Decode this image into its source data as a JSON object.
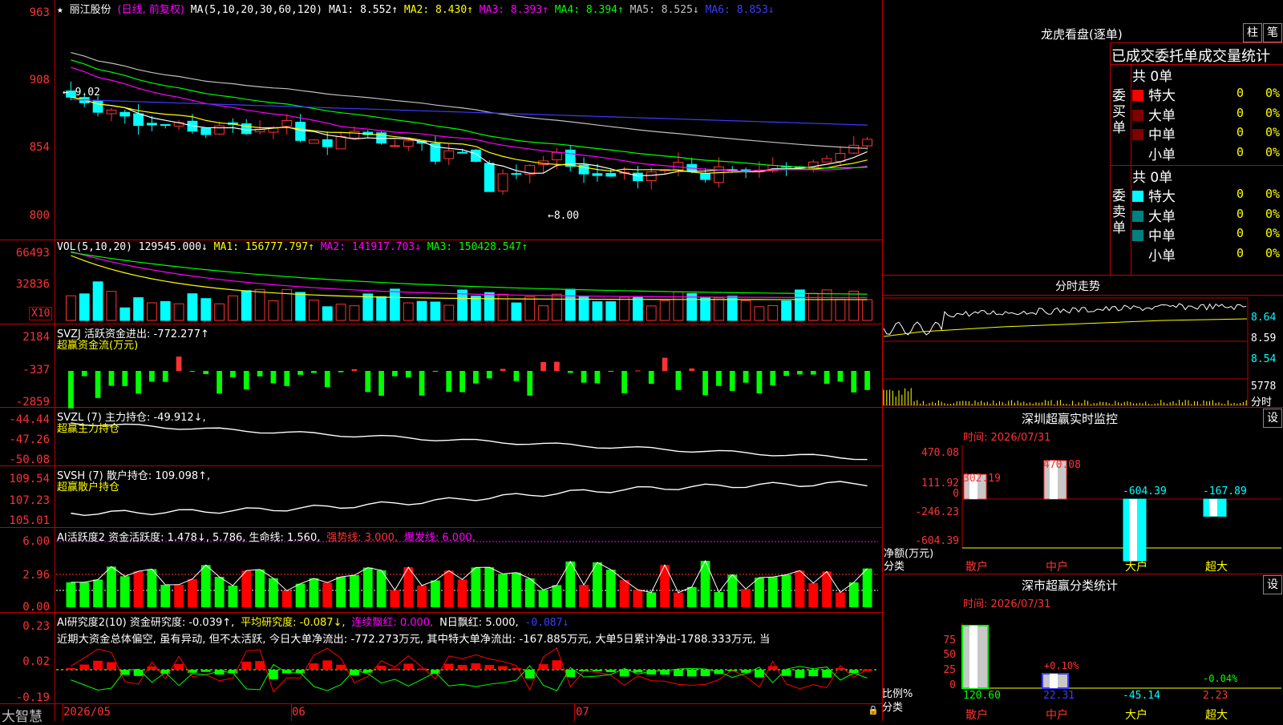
{
  "header": {
    "star": "★",
    "stock": "丽江股份",
    "period": "(日线, 前复权)",
    "ma_label": "MA(5,10,20,30,60,120)",
    "ma1": "MA1: 8.552↑",
    "ma2": "MA2: 8.430↑",
    "ma3": "MA3: 8.393↑",
    "ma4": "MA4: 8.394↑",
    "ma5": "MA5: 8.525↓",
    "ma6": "MA6: 8.853↓"
  },
  "price_axis": [
    "963",
    "908",
    "854",
    "800"
  ],
  "price_annotations": {
    "high": "← 9.02",
    "low": "←8.00"
  },
  "vol": {
    "label": "VOL(5,10,20)",
    "value": "129545.000↓",
    "ma1": "MA1: 156777.797↑",
    "ma2": "MA2: 141917.703↓",
    "ma3": "MA3: 150428.547↑",
    "axis": [
      "66493",
      "32836"
    ],
    "unit": "X10"
  },
  "svzj": {
    "label": "SVZJ  活跃资金进出: -772.277↑",
    "sub": "超赢资金流(万元)",
    "axis": [
      "2184",
      "-337",
      "-2859"
    ]
  },
  "svzl": {
    "label": "SVZL (7) 主力持仓: -49.912↓,",
    "sub": "超赢主力持仓",
    "axis": [
      "-44.44",
      "-47.26",
      "-50.08"
    ]
  },
  "svsh": {
    "label": "SVSH (7) 散户持仓: 109.098↑,",
    "sub": "超赢散户持仓",
    "axis": [
      "109.54",
      "107.23",
      "105.01"
    ]
  },
  "ai_active": {
    "label": "AI活跃度2 资金活跃度: 1.478↓, 5.786, 生命线: 1.560,",
    "strong": "强势线: 3.000,",
    "burst": "爆发线: 6.000,",
    "axis": [
      "6.00",
      "2.96",
      "0.00"
    ]
  },
  "ai_research": {
    "label": "AI研究度2(10) 资金研究度: -0.039↑,",
    "avg": "平均研究度: -0.087↓,",
    "cont": "连续飘红: 0.000,",
    "nday": "N日飘红: 5.000,",
    "last": "-0.087↓",
    "comment": "近期大资金总体偏空, 虽有异动, 但不太活跃, 今日大单净流出: -772.273万元, 其中特大单净流出: -167.885万元, 大单5日累计净出-1788.333万元, 当",
    "axis": [
      "0.23",
      "0.02",
      "-0.19"
    ]
  },
  "date_axis": {
    "brand": "大智慧",
    "d1": "2026/05",
    "d2": "06",
    "d3": "07"
  },
  "dragon_tiger": {
    "title": "龙虎看盘(逐单)",
    "btn1": "柱",
    "btn2": "笔",
    "header": "已成交委托单成交量统计",
    "buy_label": "委买单",
    "sell_label": "委卖单",
    "buy_total": "共 0单",
    "sell_total": "共 0单",
    "buy_rows": [
      {
        "name": "特大",
        "count": "0",
        "pct": "0%",
        "color": "#ff0000"
      },
      {
        "name": "大单",
        "count": "0",
        "pct": "0%",
        "color": "#800000"
      },
      {
        "name": "中单",
        "count": "0",
        "pct": "0%",
        "color": "#800000"
      },
      {
        "name": "小单",
        "count": "0",
        "pct": "0%",
        "color": ""
      }
    ],
    "sell_rows": [
      {
        "name": "特大",
        "count": "0",
        "pct": "0%",
        "color": "#00ffff"
      },
      {
        "name": "大单",
        "count": "0",
        "pct": "0%",
        "color": "#008080"
      },
      {
        "name": "中单",
        "count": "0",
        "pct": "0%",
        "color": "#008080"
      },
      {
        "name": "小单",
        "count": "0",
        "pct": "0%",
        "color": ""
      }
    ]
  },
  "intraday": {
    "title": "分时走势",
    "axis": [
      "8.64",
      "8.59",
      "8.54"
    ],
    "vol_val": "5778",
    "vol_lbl": "分时"
  },
  "monitor": {
    "title": "深圳超赢实时监控",
    "btn": "设",
    "time": "时间: 2026/07/31",
    "axis": [
      "470.08",
      "111.92",
      "0",
      "-246.23",
      "-604.39"
    ],
    "unit1": "净额(万元)",
    "unit2": "分类",
    "bars": [
      {
        "cat": "散户",
        "label": "302.19",
        "value": 302.19
      },
      {
        "cat": "中户",
        "label": "470.08",
        "value": 470.08
      },
      {
        "cat": "大户",
        "label": "-604.39",
        "value": -604.39
      },
      {
        "cat": "超大",
        "label": "-167.89",
        "value": -167.89
      }
    ]
  },
  "classify": {
    "title": "深市超赢分类统计",
    "btn": "设",
    "time": "时间: 2026/07/31",
    "axis": [
      "75",
      "50",
      "25",
      "0"
    ],
    "unit1": "比例%",
    "unit2": "分类",
    "top_labels": [
      "+0.10%",
      "-0.04%"
    ],
    "bars": [
      {
        "cat": "散户",
        "value": "120.60"
      },
      {
        "cat": "中户",
        "value": "22.31"
      },
      {
        "cat": "大户",
        "value": "-45.14"
      },
      {
        "cat": "超大",
        "value": "2.23"
      }
    ]
  },
  "chart_data": {
    "type": "candlestick",
    "title": "丽江股份",
    "ylim": [
      8.0,
      9.63
    ],
    "annotations": {
      "high": 9.02,
      "low": 8.0
    }
  }
}
